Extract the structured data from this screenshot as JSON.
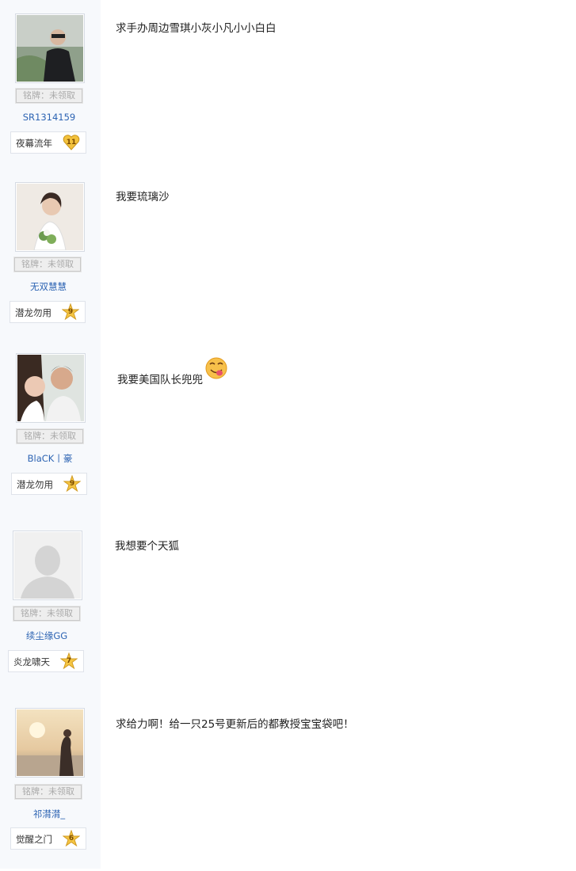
{
  "posts": [
    {
      "badge": "铭牌：未领取",
      "username": "SR1314159",
      "level_name": "夜幕流年",
      "level": "11",
      "level_icon": "heart-badge-icon",
      "content": "求手办周边雪琪小灰小凡小小白白"
    },
    {
      "badge": "铭牌：未领取",
      "username": "无双慧慧",
      "level_name": "潜龙勿用",
      "level": "9",
      "level_icon": "star-badge-icon",
      "content": "我要琉璃沙"
    },
    {
      "badge": "铭牌：未领取",
      "username": "BlaCK丨豪",
      "level_name": "潜龙勿用",
      "level": "9",
      "level_icon": "star-badge-icon",
      "content": "我要美国队长兜兜",
      "emoji": "tongue-smiley-emoji"
    },
    {
      "badge": "铭牌：未领取",
      "username": "续尘缘GG",
      "level_name": "炎龙啸天",
      "level": "7",
      "level_icon": "star-badge-icon",
      "content": "我想要个天狐"
    },
    {
      "badge": "铭牌：未领取",
      "username": "祁潸潸_",
      "level_name": "觉醒之门",
      "level": "6",
      "level_icon": "star-badge-icon",
      "content": "求给力啊！给一只25号更新后的都教授宝宝袋吧！"
    }
  ],
  "colors": {
    "sidebar_bg": "#f7f9fc",
    "username_link": "#2d64b3",
    "badge_text": "#aaaaaa",
    "level_heart": "#f3c23c",
    "level_star": "#f5c542"
  }
}
